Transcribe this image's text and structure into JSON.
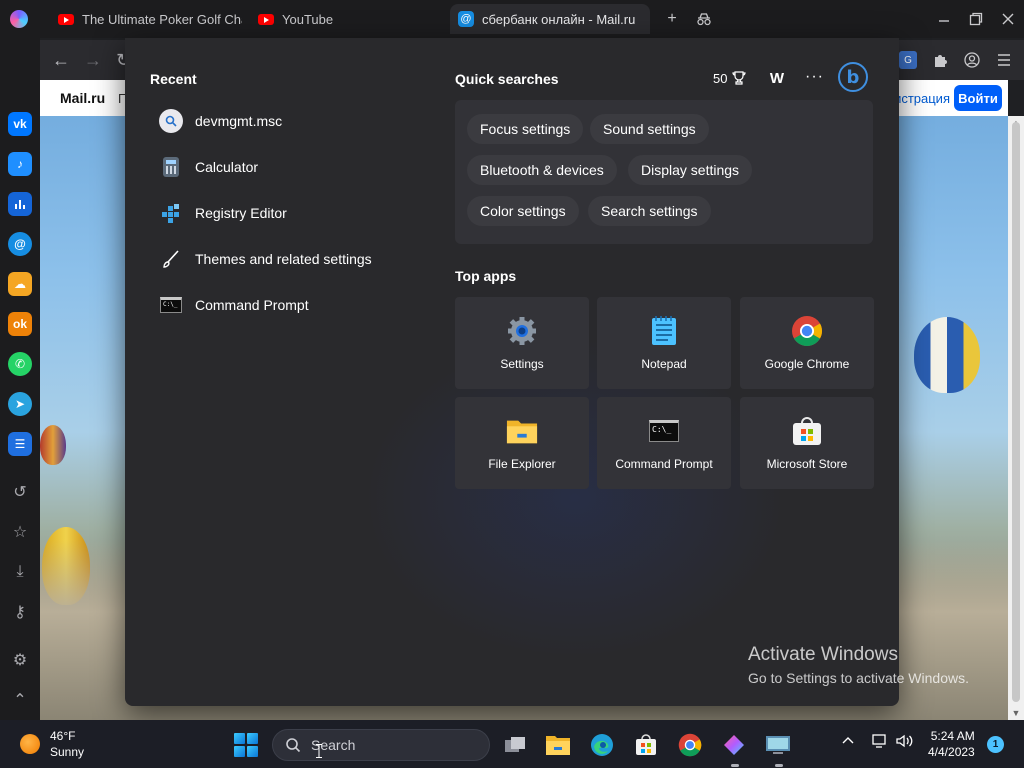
{
  "browser": {
    "tabs": [
      {
        "title": "The Ultimate Poker Golf Chal",
        "icon": "youtube-icon"
      },
      {
        "title": "YouTube",
        "icon": "youtube-icon"
      },
      {
        "title": "сбербанк онлайн - Mail.ru",
        "icon": "mail-icon",
        "active": true
      }
    ],
    "tab_close": "✕",
    "new_tab": "+",
    "page": {
      "logo": "Mail.ru",
      "partial_text": "П",
      "register": "истрация",
      "login": "Войти"
    }
  },
  "start_menu": {
    "recent_title": "Recent",
    "recent": [
      {
        "label": "devmgmt.msc",
        "icon": "search-icon"
      },
      {
        "label": "Calculator",
        "icon": "calculator-icon"
      },
      {
        "label": "Registry Editor",
        "icon": "registry-editor-icon"
      },
      {
        "label": "Themes and related settings",
        "icon": "brush-icon"
      },
      {
        "label": "Command Prompt",
        "icon": "command-prompt-icon"
      }
    ],
    "quick_searches_title": "Quick searches",
    "points": "50",
    "avatar_letter": "W",
    "more": "···",
    "bing_letter": "b",
    "quick_searches": [
      "Focus settings",
      "Sound settings",
      "Bluetooth & devices",
      "Display settings",
      "Color settings",
      "Search settings"
    ],
    "top_apps_title": "Top apps",
    "top_apps": [
      {
        "label": "Settings",
        "icon": "settings-gear-icon"
      },
      {
        "label": "Notepad",
        "icon": "notepad-icon"
      },
      {
        "label": "Google Chrome",
        "icon": "chrome-icon"
      },
      {
        "label": "File Explorer",
        "icon": "file-explorer-icon"
      },
      {
        "label": "Command Prompt",
        "icon": "command-prompt-icon"
      },
      {
        "label": "Microsoft Store",
        "icon": "microsoft-store-icon"
      }
    ],
    "cmd_glyph": "C:\\_"
  },
  "watermark": {
    "line1": "Activate Windows",
    "line2": "Go to Settings to activate Windows."
  },
  "taskbar": {
    "weather_temp": "46°F",
    "weather_desc": "Sunny",
    "search_placeholder": "Search",
    "time": "5:24 AM",
    "date": "4/4/2023",
    "notification_count": "1"
  },
  "colors": {
    "accent": "#4cc2ff",
    "mail_login": "#005ff9",
    "bing": "#3f8fe0"
  }
}
